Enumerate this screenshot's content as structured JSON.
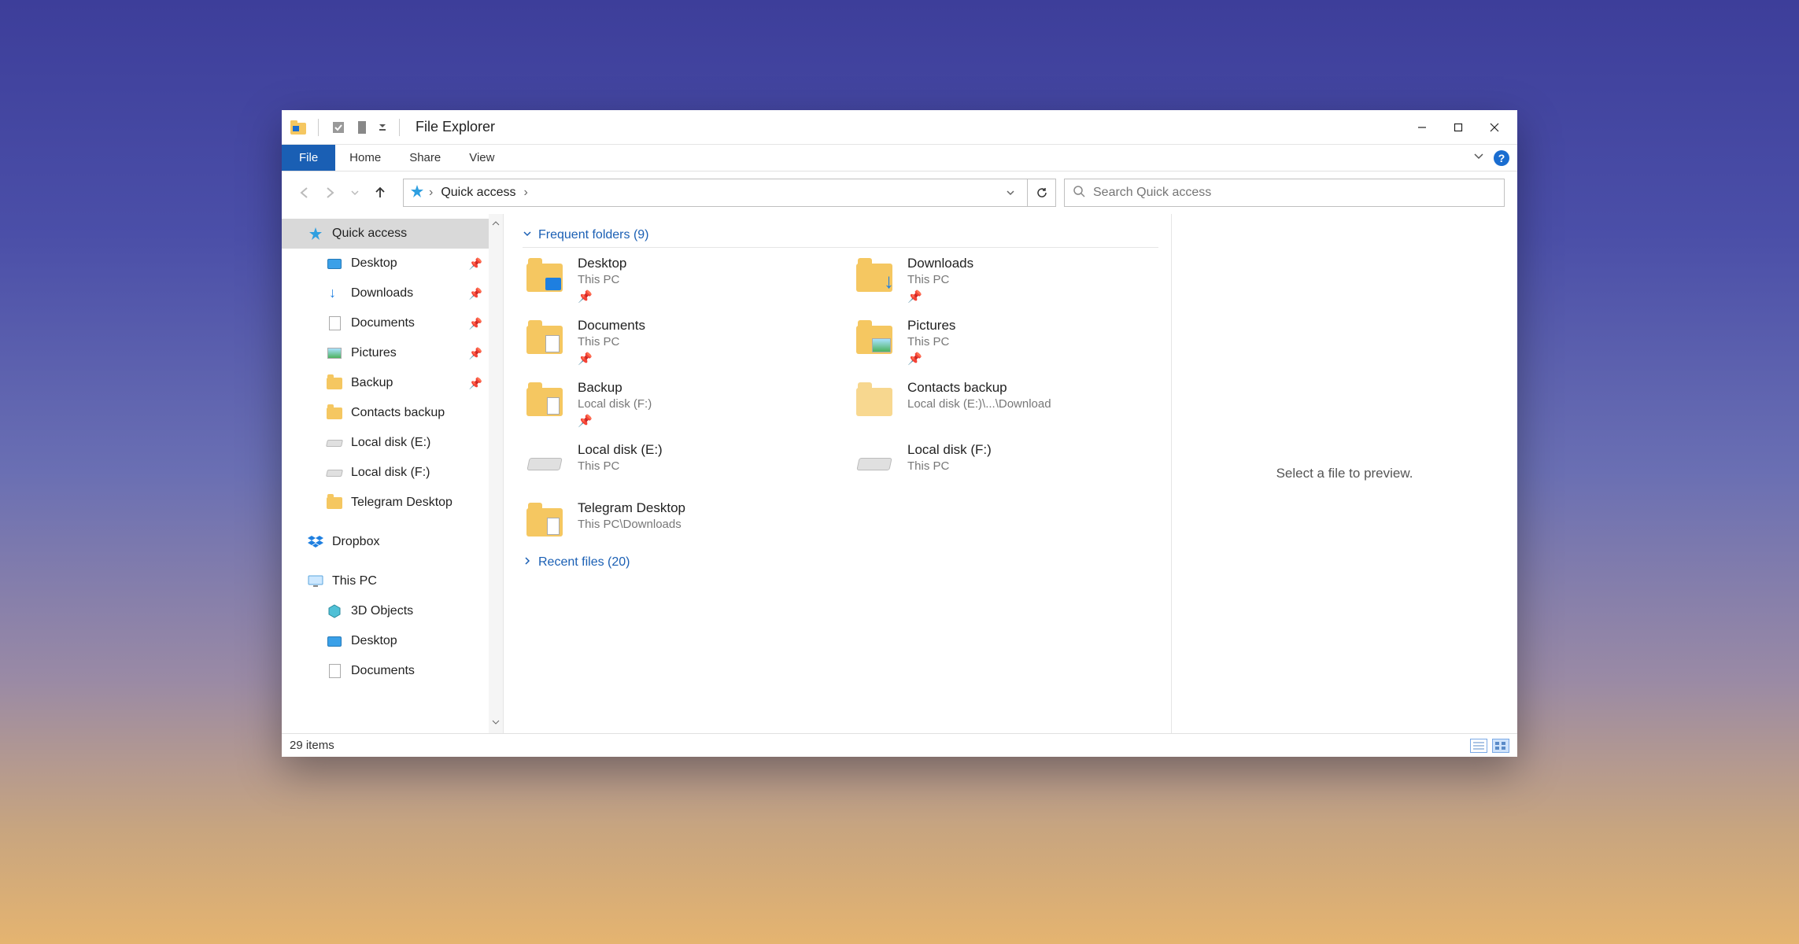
{
  "titlebar": {
    "title": "File Explorer"
  },
  "menubar": {
    "file": "File",
    "items": [
      "Home",
      "Share",
      "View"
    ]
  },
  "address": {
    "crumb": "Quick access"
  },
  "search": {
    "placeholder": "Search Quick access"
  },
  "sidebar": {
    "quick_access": "Quick access",
    "items": [
      {
        "label": "Desktop",
        "pinned": true,
        "icon": "monitor"
      },
      {
        "label": "Downloads",
        "pinned": true,
        "icon": "download"
      },
      {
        "label": "Documents",
        "pinned": true,
        "icon": "doc"
      },
      {
        "label": "Pictures",
        "pinned": true,
        "icon": "pic"
      },
      {
        "label": "Backup",
        "pinned": true,
        "icon": "folder"
      },
      {
        "label": "Contacts backup",
        "pinned": false,
        "icon": "folder"
      },
      {
        "label": "Local disk (E:)",
        "pinned": false,
        "icon": "disk"
      },
      {
        "label": "Local disk (F:)",
        "pinned": false,
        "icon": "disk"
      },
      {
        "label": "Telegram Desktop",
        "pinned": false,
        "icon": "folder"
      }
    ],
    "dropbox": "Dropbox",
    "this_pc": "This PC",
    "pc_children": [
      {
        "label": "3D Objects"
      },
      {
        "label": "Desktop"
      },
      {
        "label": "Documents"
      }
    ]
  },
  "sections": {
    "frequent_label": "Frequent folders (9)",
    "recent_label": "Recent files (20)"
  },
  "frequent": [
    {
      "name": "Desktop",
      "loc": "This PC",
      "pinned": true,
      "icon": "folder-desktop"
    },
    {
      "name": "Downloads",
      "loc": "This PC",
      "pinned": true,
      "icon": "folder-download"
    },
    {
      "name": "Documents",
      "loc": "This PC",
      "pinned": true,
      "icon": "folder-doc"
    },
    {
      "name": "Pictures",
      "loc": "This PC",
      "pinned": true,
      "icon": "folder-pic"
    },
    {
      "name": "Backup",
      "loc": "Local disk (F:)",
      "pinned": true,
      "icon": "folder"
    },
    {
      "name": "Contacts backup",
      "loc": "Local disk (E:)\\...\\Download",
      "pinned": false,
      "icon": "folder"
    },
    {
      "name": "Local disk (E:)",
      "loc": "This PC",
      "pinned": false,
      "icon": "disk"
    },
    {
      "name": "Local disk (F:)",
      "loc": "This PC",
      "pinned": false,
      "icon": "disk"
    },
    {
      "name": "Telegram Desktop",
      "loc": "This PC\\Downloads",
      "pinned": false,
      "icon": "folder"
    }
  ],
  "preview": {
    "text": "Select a file to preview."
  },
  "status": {
    "text": "29 items"
  }
}
